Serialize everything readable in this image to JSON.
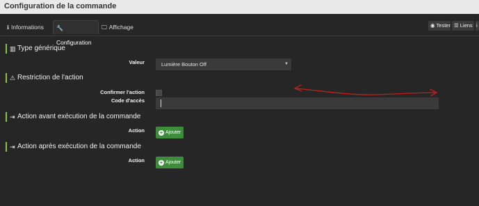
{
  "window": {
    "title": "Configuration de la commande"
  },
  "tabs": [
    {
      "label": "Informations",
      "icon": "info-circle-icon",
      "active": false
    },
    {
      "label": "Configuration",
      "icon": "wrench-icon",
      "active": true
    },
    {
      "label": "Affichage",
      "icon": "monitor-icon",
      "active": false
    }
  ],
  "toolbar": {
    "tester_label": "Tester",
    "liens_label": "Liens",
    "tester_icon": "rss-icon",
    "liens_icon": "list-icon"
  },
  "sections": {
    "type_generique": {
      "title": "Type générique",
      "icon": "building-icon"
    },
    "restriction": {
      "title": "Restriction de l'action",
      "icon": "warning-icon"
    },
    "action_avant": {
      "title": "Action avant exécution de la commande",
      "icon": "sign-in-icon"
    },
    "action_apres": {
      "title": "Action après exécution de la commande",
      "icon": "sign-in-icon"
    }
  },
  "fields": {
    "valeur_label": "Valeur",
    "valeur_selected": "Lumière Bouton Off",
    "confirmer_label": "Confirmer l'action",
    "confirmer_checked": false,
    "code_label": "Code d'accès",
    "code_value": "",
    "action_avant_label": "Action",
    "action_apres_label": "Action",
    "ajouter_label": "Ajouter"
  },
  "colors": {
    "accent_bar": "#8bc34a",
    "button_green": "#3c8c3c",
    "annotation_red": "#c0201a"
  }
}
